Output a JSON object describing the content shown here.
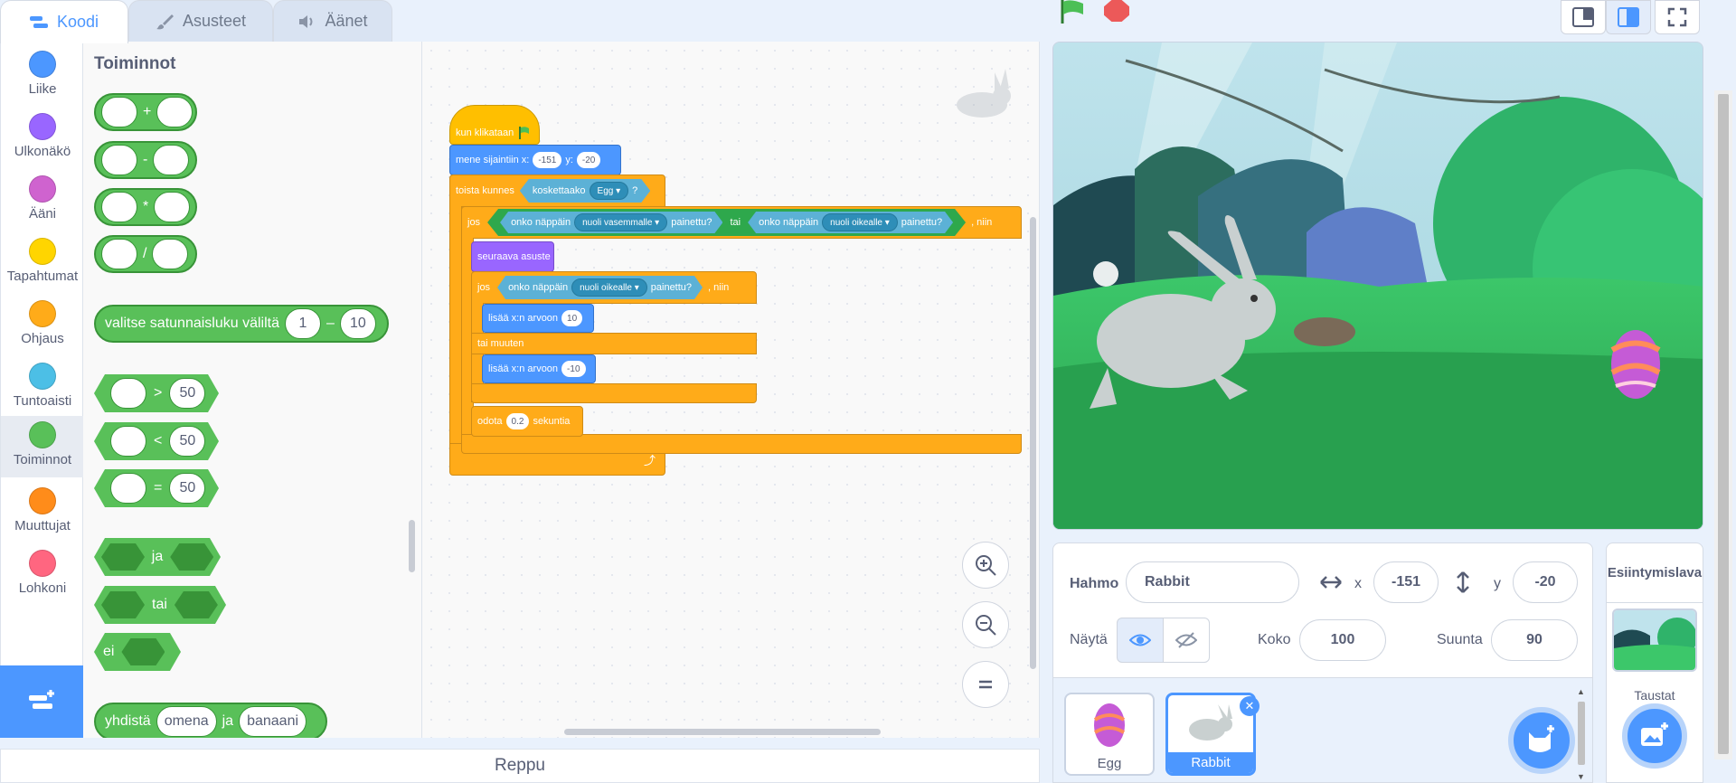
{
  "tabs": [
    {
      "label": "Koodi",
      "icon": "code-icon",
      "active": true
    },
    {
      "label": "Asusteet",
      "icon": "brush-icon"
    },
    {
      "label": "Äänet",
      "icon": "speaker-icon"
    }
  ],
  "categories": [
    {
      "label": "Liike",
      "color": "#4c97ff"
    },
    {
      "label": "Ulkonäkö",
      "color": "#9966ff"
    },
    {
      "label": "Ääni",
      "color": "#cf63cf"
    },
    {
      "label": "Tapahtumat",
      "color": "#ffd500"
    },
    {
      "label": "Ohjaus",
      "color": "#ffab19"
    },
    {
      "label": "Tuntoaisti",
      "color": "#4cbfe6"
    },
    {
      "label": "Toiminnot",
      "color": "#59c059",
      "active": true
    },
    {
      "label": "Muuttujat",
      "color": "#ff8c1a"
    },
    {
      "label": "Lohkoni",
      "color": "#ff6680"
    }
  ],
  "palette": {
    "title": "Toiminnot",
    "ops": [
      "+",
      "-",
      "*",
      "/"
    ],
    "random": {
      "text": "valitse satunnaisluku väliltä",
      "from": "1",
      "dash": "–",
      "to": "10"
    },
    "compare": [
      {
        "op": ">",
        "value": "50"
      },
      {
        "op": "<",
        "value": "50"
      },
      {
        "op": "=",
        "value": "50"
      }
    ],
    "logic": [
      "ja",
      "tai",
      "ei"
    ],
    "join": {
      "text": "yhdistä",
      "a": "omena",
      "mid": "ja",
      "b": "banaani"
    }
  },
  "script": {
    "hat": "kun klikataan",
    "goto": {
      "text": "mene sijaintiin x:",
      "x": "-151",
      "ylabel": "y:",
      "y": "-20"
    },
    "repeat_until": "toista kunnes",
    "touching": {
      "text": "koskettaako",
      "target": "Egg",
      "q": "?"
    },
    "if1": {
      "jos": "jos",
      "key1_text": "onko näppäin",
      "key1": "nuoli vasemmalle",
      "pressed": "painettu?",
      "or": "tai",
      "key2_text": "onko näppäin",
      "key2": "nuoli oikealle",
      "pressed2": "painettu?",
      "then": ", niin"
    },
    "next_costume": "seuraava asuste",
    "if2": {
      "jos": "jos",
      "key_text": "onko näppäin",
      "key": "nuoli oikealle",
      "pressed": "painettu?",
      "then": ", niin"
    },
    "change1": {
      "text": "lisää x:n arvoon",
      "value": "10"
    },
    "else": "tai muuten",
    "change2": {
      "text": "lisää x:n arvoon",
      "value": "-10"
    },
    "wait": {
      "text": "odota",
      "value": "0.2",
      "unit": "sekuntia"
    }
  },
  "backpack": "Reppu",
  "sprite_info": {
    "sprite_label": "Hahmo",
    "sprite_name": "Rabbit",
    "x_label": "x",
    "x": "-151",
    "y_label": "y",
    "y": "-20",
    "show_label": "Näytä",
    "size_label": "Koko",
    "size": "100",
    "direction_label": "Suunta",
    "direction": "90"
  },
  "sprites": [
    {
      "name": "Egg",
      "selected": false
    },
    {
      "name": "Rabbit",
      "selected": true
    }
  ],
  "stage_panel": {
    "title": "Esiintymislava",
    "backdrops_label": "Taustat"
  }
}
